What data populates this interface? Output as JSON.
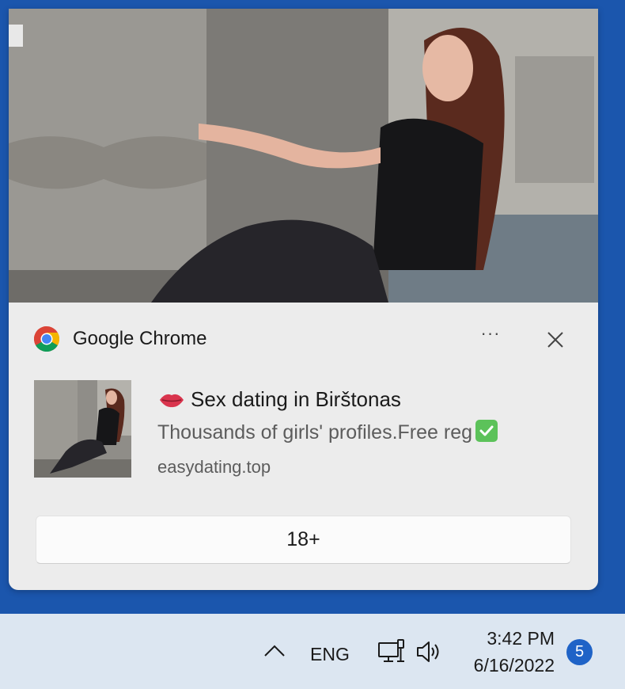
{
  "notification": {
    "app_name": "Google Chrome",
    "more_label": "···",
    "title": "Sex dating in Birštonas",
    "title_emoji": "lips-icon",
    "body": "Thousands of girls' profiles.Free reg",
    "body_emoji": "check-mark-button-icon",
    "source": "easydating.top",
    "action_label": "18+"
  },
  "taskbar": {
    "language": "ENG",
    "time": "3:42 PM",
    "date": "6/16/2022",
    "notification_count": "5"
  },
  "colors": {
    "desktop_background": "#1b56ad",
    "toast_background": "#ececec",
    "taskbar_background": "#dce6f1",
    "badge": "#1f63c7",
    "check_green": "#5cc25a"
  }
}
